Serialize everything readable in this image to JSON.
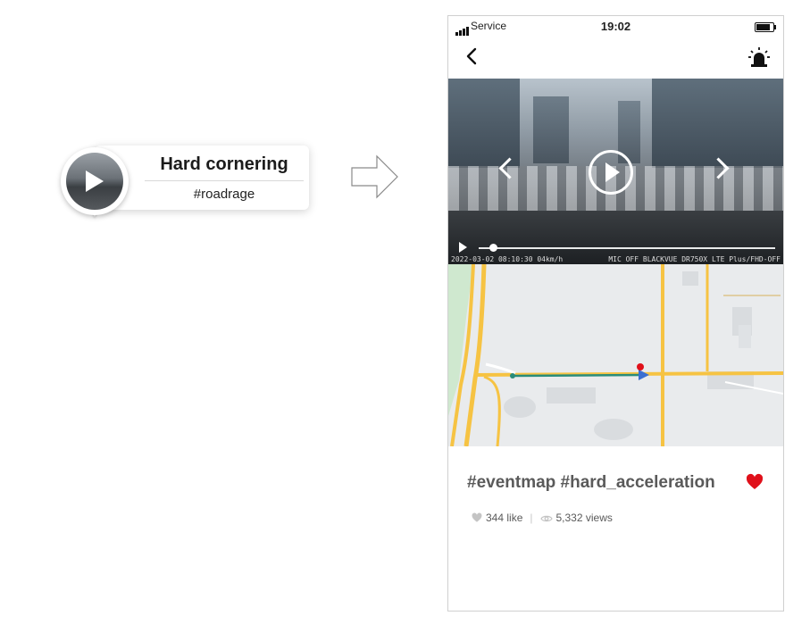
{
  "callout": {
    "title": "Hard cornering",
    "hashtag": "#roadrage"
  },
  "status_bar": {
    "carrier": "Service",
    "time": "19:02"
  },
  "video": {
    "overlay_left": "2022-03-02 08:10:30 04km/h",
    "overlay_right": "MIC OFF BLACKVUE DR750X LTE Plus/FHD-OFF",
    "progress": 0.05
  },
  "post": {
    "tags": "#eventmap #hard_acceleration",
    "likes": "344 like",
    "views": "5,332 views",
    "liked": true
  },
  "colors": {
    "accent_heart": "#e0101a",
    "route": "#2a8c7a"
  }
}
